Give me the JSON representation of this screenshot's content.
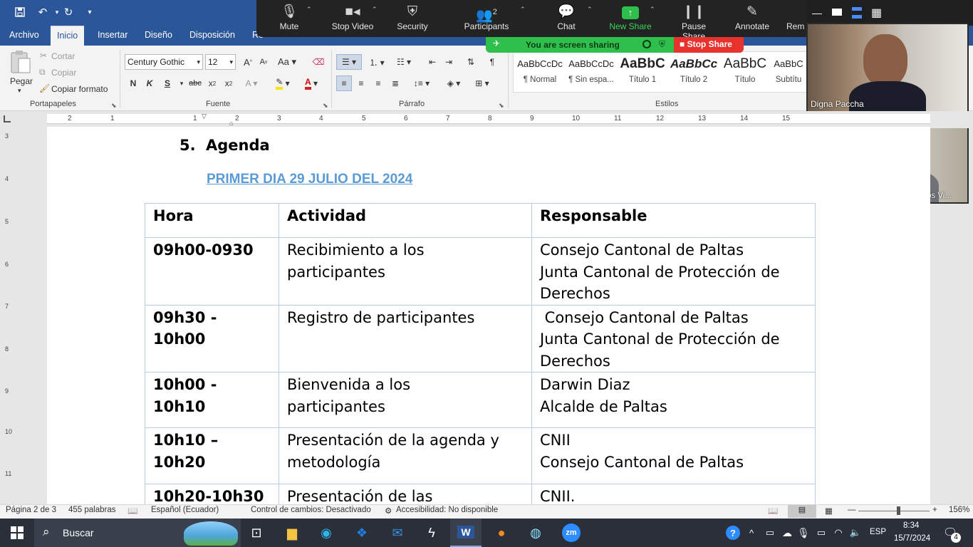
{
  "word": {
    "ribbon_tabs": [
      "Archivo",
      "Inicio",
      "Insertar",
      "Diseño",
      "Disposición",
      "Re"
    ],
    "clipboard": {
      "paste_label": "Pegar",
      "cut_label": "Cortar",
      "copy_label": "Copiar",
      "format_painter_label": "Copiar formato",
      "group_label": "Portapapeles"
    },
    "font": {
      "family": "Century Gothic",
      "size": "12",
      "group_label": "Fuente"
    },
    "paragraph": {
      "group_label": "Párrafo"
    },
    "styles": {
      "group_label": "Estilos",
      "items": [
        {
          "sample": "AaBbCcDc",
          "name": "¶ Normal"
        },
        {
          "sample": "AaBbCcDc",
          "name": "¶ Sin espa..."
        },
        {
          "sample": "AaBbC",
          "name": "Título 1"
        },
        {
          "sample": "AaBbCc",
          "name": "Título 2"
        },
        {
          "sample": "AaBbC",
          "name": "Título"
        },
        {
          "sample": "AaBbC",
          "name": "Subtítu"
        }
      ]
    },
    "ruler_numbers": [
      "2",
      "1",
      "1",
      "2",
      "3",
      "4",
      "5",
      "6",
      "7",
      "8",
      "9",
      "10",
      "11",
      "12",
      "13",
      "14",
      "15"
    ],
    "vruler_numbers": [
      "3",
      "4",
      "5",
      "6",
      "7",
      "8",
      "9",
      "10",
      "11"
    ]
  },
  "zoom": {
    "toolbar": {
      "mute": "Mute",
      "stop_video": "Stop Video",
      "security": "Security",
      "participants": "Participants",
      "participants_count": "2",
      "chat": "Chat",
      "new_share": "New Share",
      "pause_share": "Pause Share",
      "annotate": "Annotate",
      "remote": "Rem"
    },
    "sharing_banner": "You are screen sharing",
    "stop_share": "Stop Share",
    "participants_videos": [
      {
        "name": "Digna Paccha"
      },
      {
        "name": "CCPD - PALTAS Abg. Juan Carlos Vi..."
      }
    ]
  },
  "document": {
    "section_number": "5.",
    "section_title": "Agenda",
    "subtitle": "PRIMER DIA 29 JULIO DEL 2024",
    "table": {
      "headers": [
        "Hora",
        "Actividad",
        "Responsable"
      ],
      "rows": [
        {
          "hora": "09h00-0930",
          "actividad": [
            "Recibimiento a los",
            "participantes"
          ],
          "responsable": [
            "Consejo Cantonal de Paltas",
            "Junta Cantonal de Protección de",
            "Derechos"
          ]
        },
        {
          "hora": "09h30 - 10h00",
          "actividad": [
            "Registro de participantes"
          ],
          "responsable": [
            " Consejo Cantonal de Paltas",
            "Junta Cantonal de Protección de",
            "Derechos"
          ]
        },
        {
          "hora": "10h00 - 10h10",
          "actividad": [
            "Bienvenida a los",
            "participantes"
          ],
          "responsable": [
            "Darwin Diaz",
            "Alcalde de Paltas"
          ]
        },
        {
          "hora": "10h10 – 10h20",
          "actividad": [
            "Presentación de la agenda y",
            "metodología"
          ],
          "responsable": [
            "CNII",
            "Consejo Cantonal de Paltas"
          ]
        },
        {
          "hora": "10h20-10h30",
          "actividad": [
            "Presentación de las"
          ],
          "responsable": [
            "CNII."
          ]
        }
      ]
    }
  },
  "statusbar": {
    "page": "Página 2 de 3",
    "words": "455 palabras",
    "language": "Español (Ecuador)",
    "track_changes": "Control de cambios: Desactivado",
    "accessibility": "Accesibilidad: No disponible",
    "zoom_level": "156%"
  },
  "taskbar": {
    "search_label": "Buscar",
    "language": "ESP",
    "time": "8:34",
    "date": "15/7/2024",
    "notifications": "4"
  },
  "colors": {
    "word_blue": "#2b579a",
    "subtitle_blue": "#5b9bd5",
    "share_green": "#2fbf4d",
    "stop_red": "#e8322e",
    "zoom_dark": "#232323"
  }
}
